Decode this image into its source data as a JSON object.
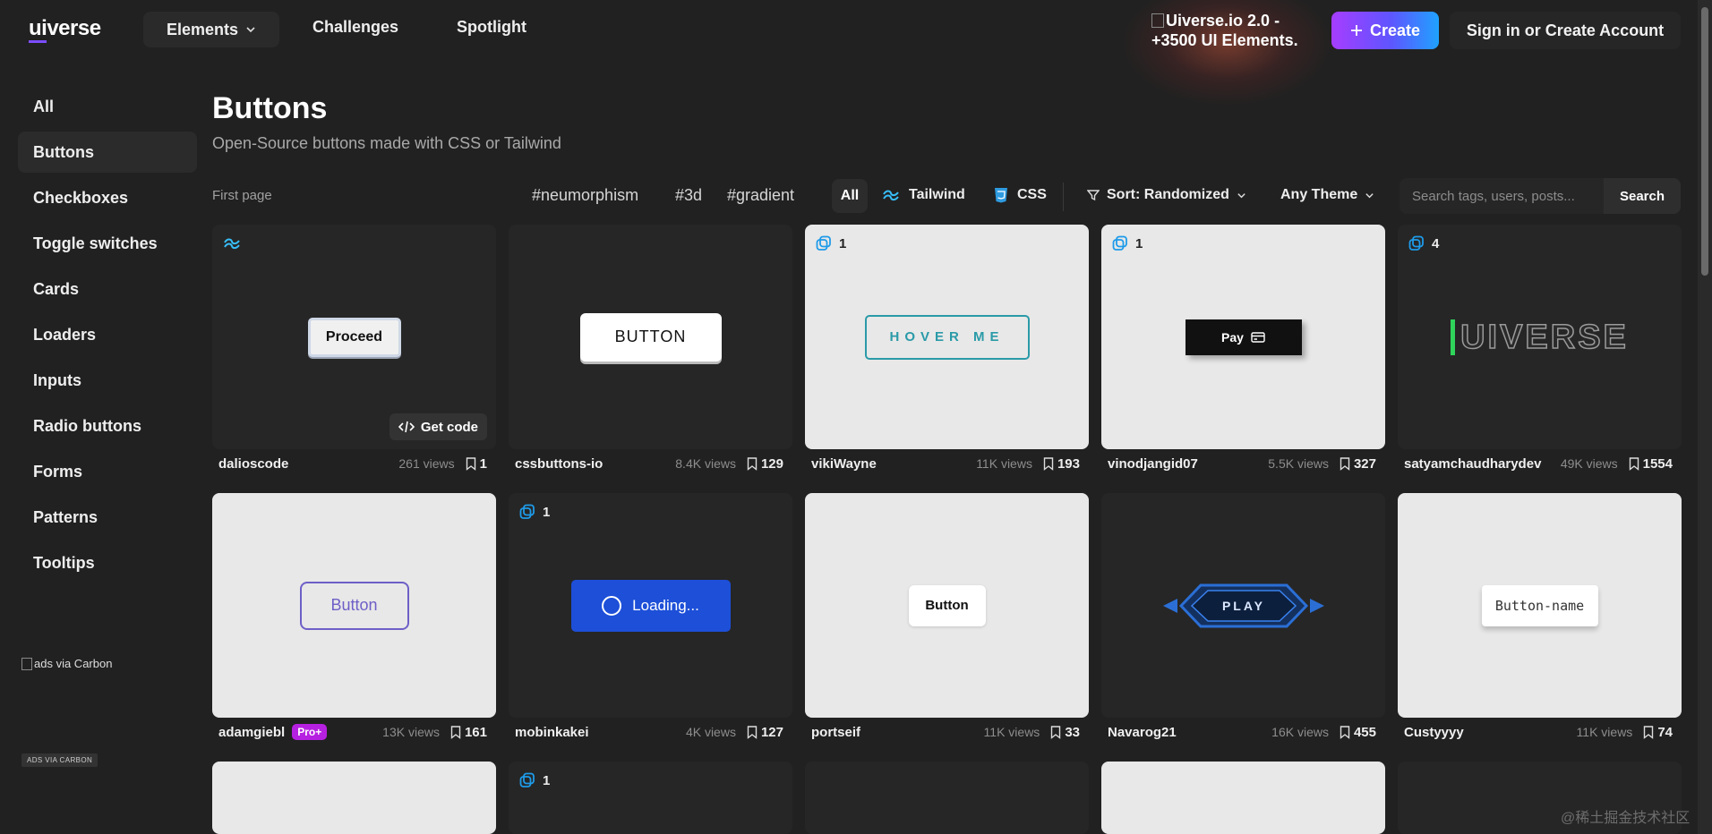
{
  "header": {
    "logo_prefix": "ui",
    "logo_suffix": "verse",
    "nav_elements": "Elements",
    "nav_challenges": "Challenges",
    "nav_spotlight": "Spotlight",
    "promo_alt": "Uiverse.io 2.0 - +3500 UI Elements.",
    "create": "Create",
    "signin": "Sign in or Create Account"
  },
  "sidebar": {
    "items": [
      {
        "label": "All"
      },
      {
        "label": "Buttons",
        "active": true
      },
      {
        "label": "Checkboxes"
      },
      {
        "label": "Toggle switches"
      },
      {
        "label": "Cards"
      },
      {
        "label": "Loaders"
      },
      {
        "label": "Inputs"
      },
      {
        "label": "Radio buttons"
      },
      {
        "label": "Forms"
      },
      {
        "label": "Patterns"
      },
      {
        "label": "Tooltips"
      }
    ],
    "ads_alt": "ads via Carbon",
    "ads_label": "ADS VIA CARBON"
  },
  "main": {
    "title": "Buttons",
    "subtitle": "Open-Source buttons made with CSS or Tailwind",
    "first_page": "First page",
    "tags": [
      "#neumorphism",
      "#3d",
      "#gradient"
    ],
    "filter_all": "All",
    "filter_tailwind": "Tailwind",
    "filter_css": "CSS",
    "sort": "Sort: Randomized",
    "theme": "Any Theme",
    "search_placeholder": "Search tags, users, posts...",
    "search_button": "Search"
  },
  "cards": [
    {
      "author": "dalioscode",
      "views": "261 views",
      "saves": "1",
      "preview": "Proceed",
      "get_code": "Get code"
    },
    {
      "author": "cssbuttons-io",
      "views": "8.4K views",
      "saves": "129",
      "preview": "BUTTON"
    },
    {
      "author": "vikiWayne",
      "views": "11K views",
      "saves": "193",
      "preview": "HOVER ME",
      "copies": "1"
    },
    {
      "author": "vinodjangid07",
      "views": "5.5K views",
      "saves": "327",
      "preview": "Pay",
      "copies": "1"
    },
    {
      "author": "satyamchaudharydev",
      "views": "49K views",
      "saves": "1554",
      "preview": "UIVERSE",
      "copies": "4"
    },
    {
      "author": "adamgiebl",
      "pro": "Pro+",
      "views": "13K views",
      "saves": "161",
      "preview": "Button"
    },
    {
      "author": "mobinkakei",
      "views": "4K views",
      "saves": "127",
      "preview": "Loading...",
      "copies": "1"
    },
    {
      "author": "portseif",
      "views": "11K views",
      "saves": "33",
      "preview": "Button"
    },
    {
      "author": "Navarog21",
      "views": "16K views",
      "saves": "455",
      "preview": "PLAY"
    },
    {
      "author": "Custyyyy",
      "views": "11K views",
      "saves": "74",
      "preview": "Button-name"
    }
  ],
  "row3_copies": "1",
  "watermark": "@稀土掘金技术社区",
  "colors": {
    "accent": "#7c4dff",
    "tailwind": "#38bdf8",
    "css": "#2f9be0"
  }
}
